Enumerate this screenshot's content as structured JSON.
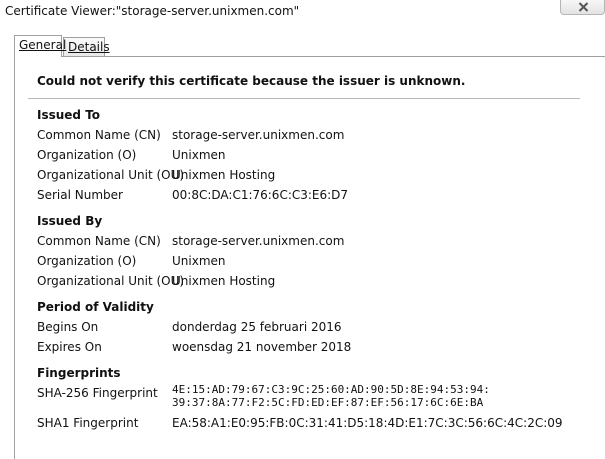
{
  "window": {
    "title": "Certificate Viewer:\"storage-server.unixmen.com\""
  },
  "tabs": [
    {
      "label": "General"
    },
    {
      "label": "Details"
    }
  ],
  "general": {
    "warning": "Could not verify this certificate because the issuer is unknown.",
    "issued_to": {
      "heading": "Issued To",
      "cn_label": "Common Name (CN)",
      "cn": "storage-server.unixmen.com",
      "o_label": "Organization (O)",
      "o": "Unixmen",
      "ou_label": "Organizational Unit (OU)",
      "ou": "Unixmen Hosting",
      "serial_label": "Serial Number",
      "serial": "00:8C:DA:C1:76:6C:C3:E6:D7"
    },
    "issued_by": {
      "heading": "Issued By",
      "cn_label": "Common Name (CN)",
      "cn": "storage-server.unixmen.com",
      "o_label": "Organization (O)",
      "o": "Unixmen",
      "ou_label": "Organizational Unit (OU)",
      "ou": "Unixmen Hosting"
    },
    "validity": {
      "heading": "Period of Validity",
      "begins_label": "Begins On",
      "begins": "donderdag 25 februari 2016",
      "expires_label": "Expires On",
      "expires": "woensdag 21 november 2018"
    },
    "fingerprints": {
      "heading": "Fingerprints",
      "sha256_label": "SHA-256 Fingerprint",
      "sha256_line1": "4E:15:AD:79:67:C3:9C:25:60:AD:90:5D:8E:94:53:94:",
      "sha256_line2": "39:37:8A:77:F2:5C:FD:ED:EF:87:EF:56:17:6C:6E:BA",
      "sha1_label": "SHA1 Fingerprint",
      "sha1": "EA:58:A1:E0:95:FB:0C:31:41:D5:18:4D:E1:7C:3C:56:6C:4C:2C:09"
    }
  }
}
